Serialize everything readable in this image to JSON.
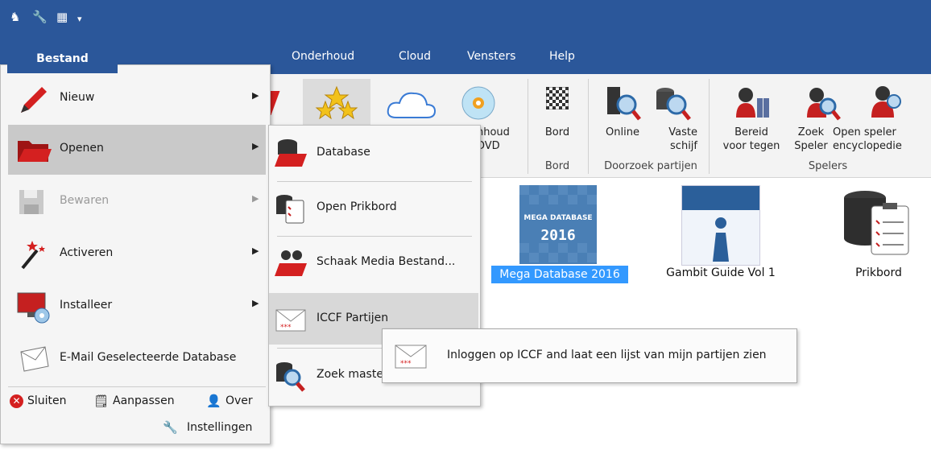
{
  "menu_tabs": [
    "Bestand",
    "Onderhoud",
    "Cloud",
    "Vensters",
    "Help"
  ],
  "ribbon": {
    "buttons": [
      {
        "label": "nhoud\nDVD"
      },
      {
        "label": "Bord"
      },
      {
        "label": "Online"
      },
      {
        "label": "Vaste\nschijf"
      },
      {
        "label": "Bereid\nvoor tegen"
      },
      {
        "label": "Zoek\nSpeler"
      },
      {
        "label": "Open speler\nencyclopedie"
      }
    ],
    "groups": [
      "Bord",
      "Doorzoek partijen",
      "Spelers"
    ]
  },
  "databases": [
    "Mega Database 2016",
    "Gambit Guide Vol 1",
    "Prikbord"
  ],
  "mega_tile": {
    "line1": "MEGA DATABASE",
    "line2": "2016"
  },
  "app_menu": {
    "items": [
      {
        "label": "Nieuw",
        "has_arrow": true
      },
      {
        "label": "Openen",
        "has_arrow": true
      },
      {
        "label": "Bewaren",
        "has_arrow": true
      },
      {
        "label": "Activeren",
        "has_arrow": true
      },
      {
        "label": "Installeer",
        "has_arrow": true
      },
      {
        "label": "E-Mail Geselecteerde Database",
        "has_arrow": false
      }
    ],
    "footer": [
      "Sluiten",
      "Aanpassen",
      "Over",
      "Instellingen"
    ]
  },
  "submenu": {
    "items": [
      "Database",
      "Open Prikbord",
      "Schaak Media Bestand...",
      "ICCF Partijen",
      "Zoek maste"
    ]
  },
  "tooltip": "Inloggen op ICCF and laat een lijst van mijn partijen zien",
  "colors": {
    "accent": "#2b579a",
    "selection": "#3399ff",
    "red": "#d42020"
  }
}
